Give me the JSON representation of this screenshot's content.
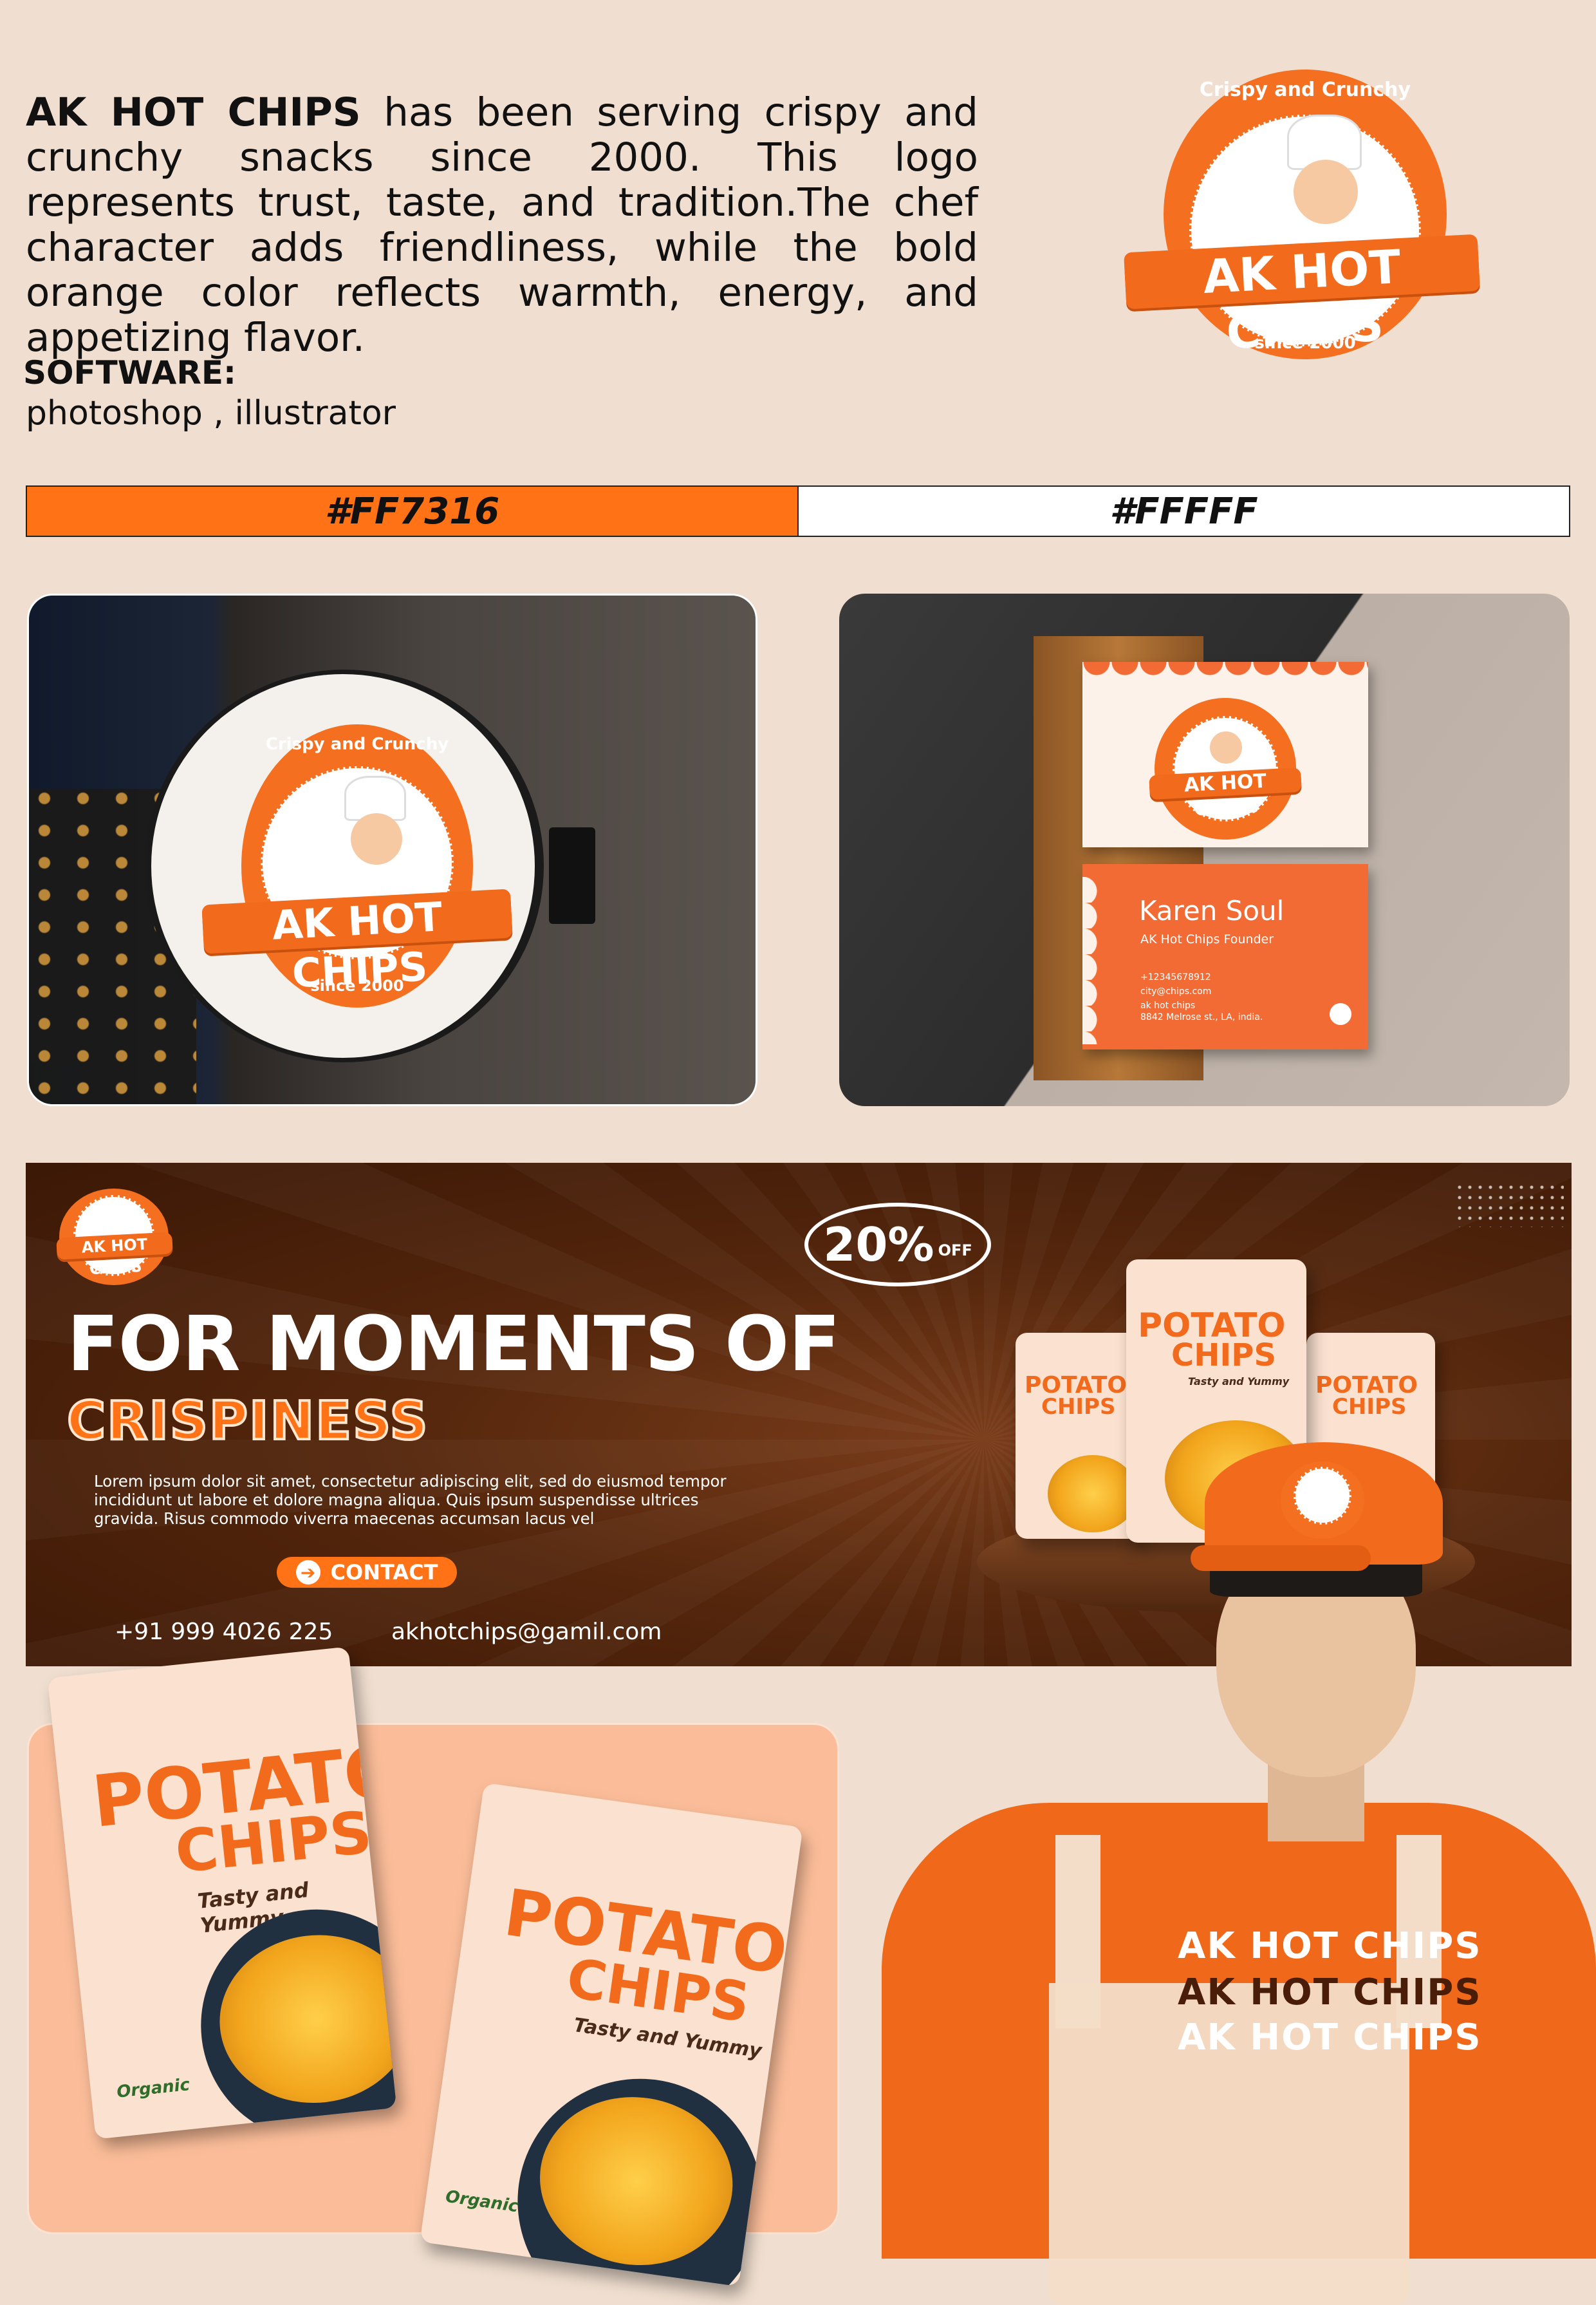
{
  "intro": {
    "brand": "AK HOT CHIPS",
    "text": " has been serving crispy and crunchy snacks since 2000. This logo represents trust, taste, and tradition.The chef character adds friendliness, while the bold orange color reflects warmth, energy, and appetizing flavor."
  },
  "software": {
    "title": "SOFTWARE:",
    "value": "photoshop , illustrator"
  },
  "palette": {
    "primary_label": "#FF7316",
    "secondary_label": "#FFFFF",
    "primary_color": "#ff7316",
    "secondary_color": "#ffffff"
  },
  "logo": {
    "arc_text": "Crispy and Crunchy",
    "name": "AK HOT CHIPS",
    "since": "since 2000"
  },
  "business_card": {
    "name": "Karen Soul",
    "role": "AK Hot Chips Founder",
    "phone": "+12345678912",
    "email": "city@chips.com",
    "company": "ak hot chips",
    "address": "8842 Melrose st., LA, india."
  },
  "banner": {
    "headline": "FOR MOMENTS OF",
    "subheadline": "CRISPINESS",
    "body": "Lorem ipsum dolor sit amet, consectetur adipiscing elit, sed do eiusmod tempor incididunt ut labore et dolore magna aliqua. Quis ipsum suspendisse ultrices gravida. Risus commodo viverra maecenas accumsan lacus vel",
    "contact_label": "CONTACT",
    "phone": "+91 999 4026 225",
    "email": "akhotchips@gamil.com",
    "discount": "20%",
    "discount_suffix": "OFF"
  },
  "bag": {
    "title_line1": "POTATO",
    "title_line2": "CHIPS",
    "tagline": "Tasty and Yummy",
    "badge": "Organic"
  },
  "shirt": {
    "lines": [
      "AK HOT CHIPS",
      "AK HOT CHIPS",
      "AK HOT CHIPS"
    ]
  }
}
